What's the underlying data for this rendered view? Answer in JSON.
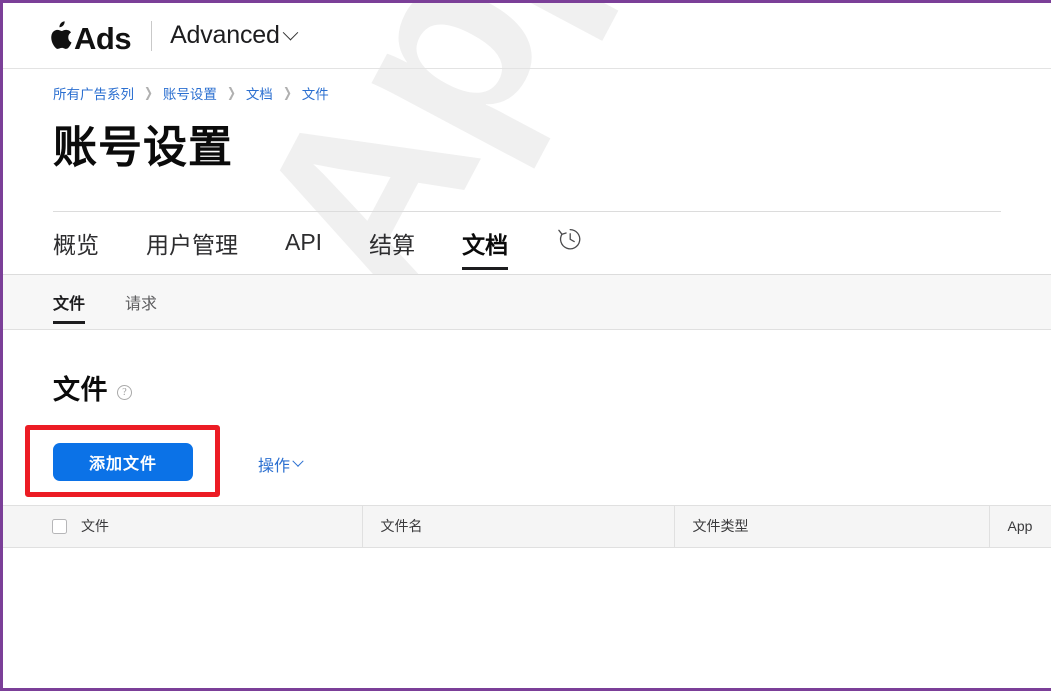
{
  "topbar": {
    "brand_name": "Ads",
    "apple_logo_icon": "apple-logo-icon",
    "account_type": "Advanced",
    "account_chevron_icon": "chevron-down-icon"
  },
  "breadcrumb": {
    "items": [
      {
        "label": "所有广告系列"
      },
      {
        "label": "账号设置"
      },
      {
        "label": "文档"
      },
      {
        "label": "文件"
      }
    ],
    "separator": "❯"
  },
  "page": {
    "title": "账号设置"
  },
  "tabs": [
    {
      "label": "概览",
      "active": false
    },
    {
      "label": "用户管理",
      "active": false
    },
    {
      "label": "API",
      "active": false
    },
    {
      "label": "结算",
      "active": false
    },
    {
      "label": "文档",
      "active": true
    }
  ],
  "history_tab": {
    "icon": "history-clock-icon"
  },
  "subtabs": [
    {
      "label": "文件",
      "active": true
    },
    {
      "label": "请求",
      "active": false
    }
  ],
  "section": {
    "title": "文件",
    "help_icon": "question-mark-circle-icon"
  },
  "actions": {
    "add_file_label": "添加文件",
    "ops_label": "操作",
    "ops_chevron_icon": "chevron-down-icon",
    "highlight_color": "#ec1c24",
    "primary_button_color": "#0b72e7",
    "link_color": "#2b6fd0"
  },
  "table": {
    "select_all_checkbox": "select-all-checkbox",
    "columns": [
      {
        "label": "文件"
      },
      {
        "label": "文件名"
      },
      {
        "label": "文件类型"
      },
      {
        "label": "App"
      }
    ],
    "rows": []
  },
  "watermark": {
    "text": "AppsA"
  }
}
